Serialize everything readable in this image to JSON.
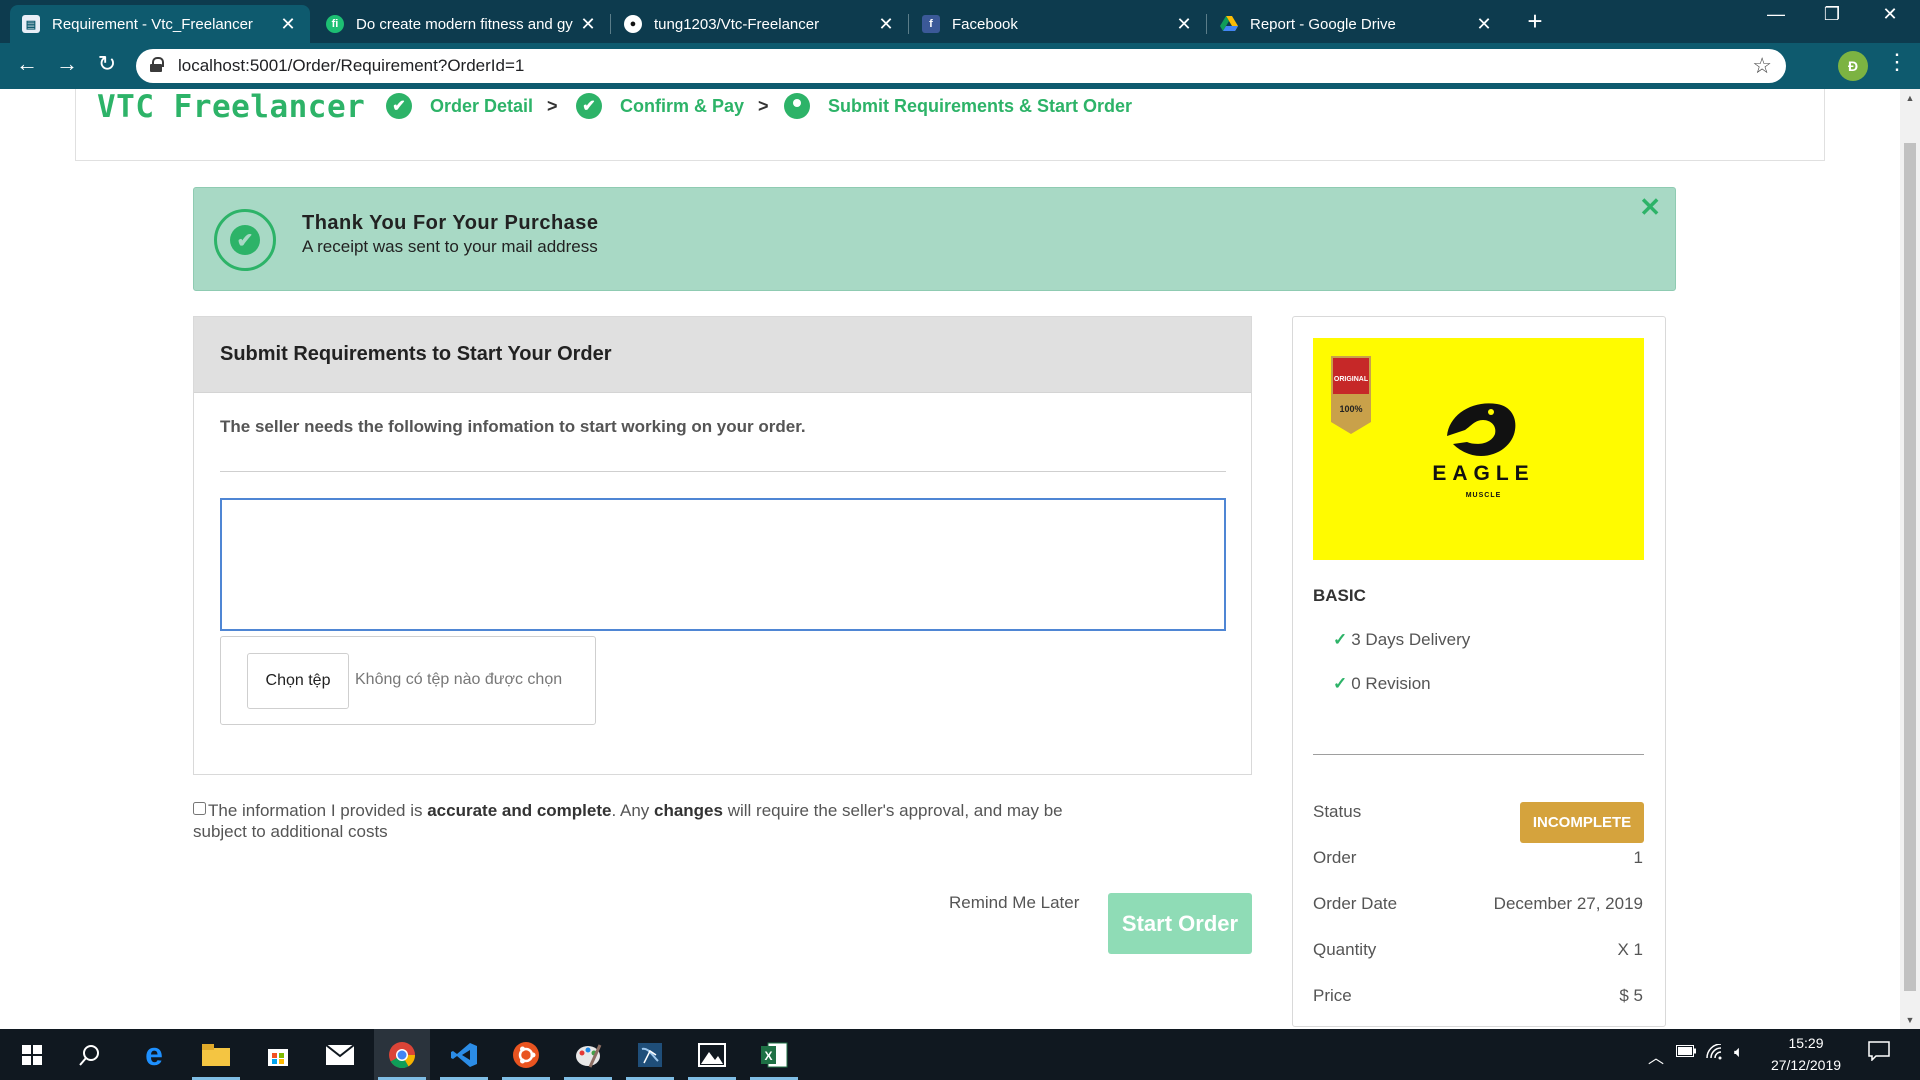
{
  "browser": {
    "tabs": [
      {
        "title": "Requirement - Vtc_Freelancer",
        "active": true,
        "icon": "document-icon"
      },
      {
        "title": "Do create modern fitness and gy",
        "active": false,
        "icon": "fiverr-icon"
      },
      {
        "title": "tung1203/Vtc-Freelancer",
        "active": false,
        "icon": "github-icon"
      },
      {
        "title": "Facebook",
        "active": false,
        "icon": "facebook-icon"
      },
      {
        "title": "Report - Google Drive",
        "active": false,
        "icon": "google-drive-icon"
      }
    ],
    "url": "localhost:5001/Order/Requirement?OrderId=1",
    "profile_initial": "Đ"
  },
  "header": {
    "logo": "VTC Freelancer",
    "steps": [
      {
        "label": "Order Detail",
        "icon": "check-circle-icon"
      },
      {
        "label": "Confirm & Pay",
        "icon": "check-circle-icon"
      },
      {
        "label": "Submit Requirements & Start Order",
        "icon": "map-pin-icon"
      }
    ],
    "separator": ">"
  },
  "banner": {
    "title": "Thank You For Your Purchase",
    "subtitle": "A receipt was sent to your mail address"
  },
  "requirements": {
    "heading": "Submit Requirements to Start Your Order",
    "description": "The seller needs the following infomation to start working on your order.",
    "textarea_value": "",
    "file_button": "Chọn tệp",
    "file_status": "Không có tệp nào được chọn"
  },
  "agreement": {
    "text_1": "The information I provided is ",
    "bold_1": "accurate and complete",
    "text_2": ". Any ",
    "bold_2": "changes",
    "text_3": " will require the seller's approval, and may be subject to additional costs",
    "checked": false
  },
  "actions": {
    "remind_label": "Remind Me Later",
    "start_label": "Start Order"
  },
  "gig": {
    "image_brand": "EAGLE",
    "image_tagline": "MUSCLE",
    "badge_top": "ORIGINAL",
    "badge_bottom": "100%",
    "package": "BASIC",
    "features": [
      "3 Days Delivery",
      "0 Revision"
    ],
    "status_label": "Status",
    "status_value": "INCOMPLETE",
    "order_label": "Order",
    "order_value": "1",
    "date_label": "Order Date",
    "date_value": "December 27, 2019",
    "qty_label": "Quantity",
    "qty_value": "X 1",
    "price_label": "Price",
    "price_value": "$ 5"
  },
  "taskbar": {
    "time": "15:29",
    "date": "27/12/2019",
    "apps": [
      "start-icon",
      "search-icon",
      "edge-icon",
      "file-explorer-icon",
      "store-icon",
      "mail-icon",
      "chrome-icon",
      "vscode-icon",
      "ubuntu-icon",
      "paint-icon",
      "sql-server-icon",
      "photos-icon",
      "excel-icon"
    ]
  },
  "colors": {
    "brand_green": "#2db368",
    "banner_bg": "#a8d9c5",
    "start_btn": "#8fdcb6",
    "status_badge": "#d5a33d",
    "chrome_tabstrip": "#0d3b4e",
    "chrome_toolbar": "#0e5a6e"
  }
}
